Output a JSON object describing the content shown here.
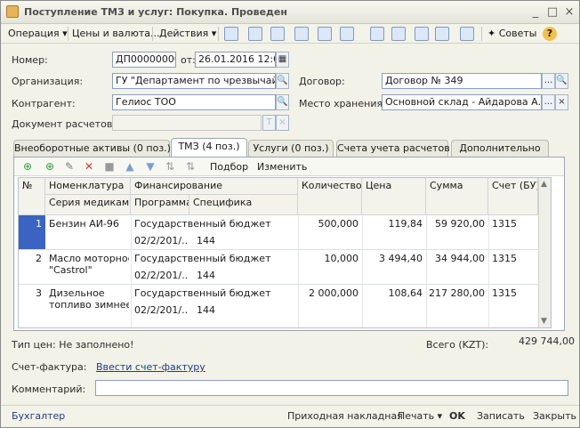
{
  "window": {
    "title": "Поступление ТМЗ и услуг: Покупка. Проведен"
  },
  "toolbar": {
    "operation": "Операция",
    "prices_currency": "Цены и валюта...",
    "actions": "Действия",
    "advice": "Советы"
  },
  "form": {
    "number_label": "Номер:",
    "number_value": "ДП00000000",
    "date_prefix": "от:",
    "date_value": "26.01.2016 12:00:",
    "organization_label": "Организация:",
    "organization_value": "ГУ \"Департамент по чрезвычай",
    "contract_label": "Договор:",
    "contract_value": "Договор № 349",
    "counterparty_label": "Контрагент:",
    "counterparty_value": "Гелиос ТОО",
    "storage_label": "Место хранения:",
    "storage_value": "Основной склад - Айдарова А.Т",
    "doc_label": "Документ расчетов:",
    "doc_value": ""
  },
  "tabs": [
    "Внеоборотные активы (0 поз.)",
    "ТМЗ (4 поз.)",
    "Услуги (0 поз.)",
    "Счета учета расчетов",
    "Дополнительно"
  ],
  "grid_tools": {
    "select": "Подбор",
    "edit": "Изменить"
  },
  "table": {
    "headers": {
      "num": "№",
      "nomenclature": "Номенклатура",
      "series": "Серия медикам...",
      "financing": "Финансирование",
      "program": "Программа",
      "specific": "Специфика",
      "quantity": "Количество",
      "price": "Цена",
      "sum": "Сумма",
      "account": "Счет (БУ)"
    },
    "rows": [
      {
        "num": "1",
        "name": "Бензин АИ-96",
        "name2": "",
        "financing": "Государственный бюджет",
        "program": "02/2/201/...",
        "specific": "144",
        "quantity": "500,000",
        "price": "119,84",
        "sum": "59 920,00",
        "account": "1315"
      },
      {
        "num": "2",
        "name": "Масло моторное",
        "name2": "\"Castrol\"",
        "financing": "Государственный бюджет",
        "program": "02/2/201/...",
        "specific": "144",
        "quantity": "10,000",
        "price": "3 494,40",
        "sum": "34 944,00",
        "account": "1315"
      },
      {
        "num": "3",
        "name": "Дизельное",
        "name2": "топливо зимнее",
        "financing": "Государственный бюджет",
        "program": "02/2/201/...",
        "specific": "144",
        "quantity": "2 000,000",
        "price": "108,64",
        "sum": "217 280,00",
        "account": "1315"
      }
    ]
  },
  "summary": {
    "price_type": "Тип цен: Не заполнено!",
    "total_label": "Всего (KZT):",
    "total_value": "429 744,00"
  },
  "invoice": {
    "label": "Счет-фактура:",
    "link": "Ввести счет-фактуру"
  },
  "comment": {
    "label": "Комментарий:",
    "value": ""
  },
  "footer": {
    "accountant": "Бухгалтер",
    "receipt": "Приходная накладная",
    "print": "Печать",
    "ok": "OK",
    "save": "Записать",
    "close": "Закрыть"
  }
}
